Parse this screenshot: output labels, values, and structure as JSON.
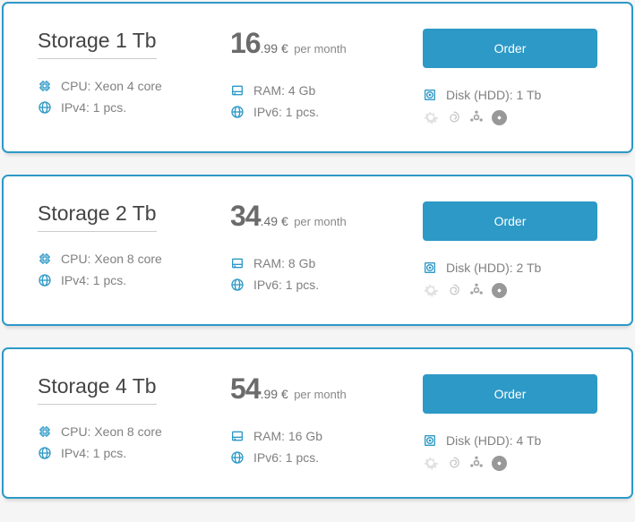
{
  "cards": [
    {
      "title": "Storage 1 Tb",
      "price_big": "16",
      "price_small": ".99 €",
      "period": "per month",
      "cpu": "CPU: Xeon 4 core",
      "ram": "RAM: 4 Gb",
      "disk": "Disk (HDD): 1 Tb",
      "ipv4": "IPv4: 1 pcs.",
      "ipv6": "IPv6: 1 pcs.",
      "order": "Order"
    },
    {
      "title": "Storage 2 Tb",
      "price_big": "34",
      "price_small": ".49 €",
      "period": "per month",
      "cpu": "CPU: Xeon 8 core",
      "ram": "RAM: 8 Gb",
      "disk": "Disk (HDD): 2 Tb",
      "ipv4": "IPv4: 1 pcs.",
      "ipv6": "IPv6: 1 pcs.",
      "order": "Order"
    },
    {
      "title": "Storage 4 Tb",
      "price_big": "54",
      "price_small": ".99 €",
      "period": "per month",
      "cpu": "CPU: Xeon 8 core",
      "ram": "RAM: 16 Gb",
      "disk": "Disk (HDD): 4 Tb",
      "ipv4": "IPv4: 1 pcs.",
      "ipv6": "IPv6: 1 pcs.",
      "order": "Order"
    }
  ]
}
